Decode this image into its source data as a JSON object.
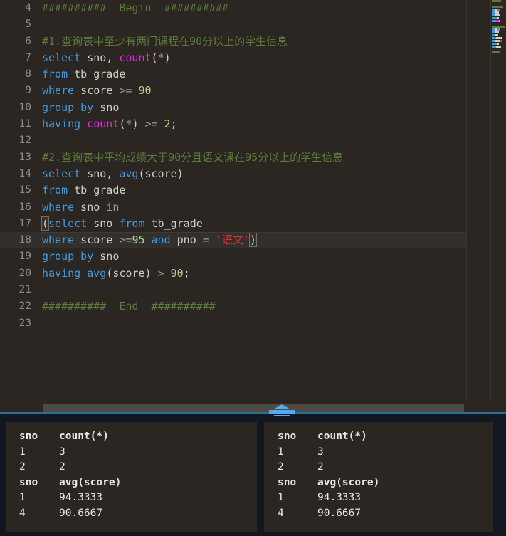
{
  "editor": {
    "first_visible_line": 4,
    "current_line": 18,
    "lines": [
      {
        "n": 4,
        "tokens": [
          {
            "t": "cmt",
            "v": "##########  Begin  ##########"
          }
        ]
      },
      {
        "n": 5,
        "tokens": []
      },
      {
        "n": 6,
        "tokens": [
          {
            "t": "cmt",
            "v": "#1.查询表中至少有两门课程在90分以上的学生信息"
          }
        ]
      },
      {
        "n": 7,
        "tokens": [
          {
            "t": "kw",
            "v": "select"
          },
          {
            "t": "id",
            "v": " sno"
          },
          {
            "t": "pun",
            "v": ", "
          },
          {
            "t": "fn",
            "v": "count"
          },
          {
            "t": "pun",
            "v": "("
          },
          {
            "t": "op",
            "v": "*"
          },
          {
            "t": "pun",
            "v": ")"
          }
        ]
      },
      {
        "n": 8,
        "tokens": [
          {
            "t": "kw",
            "v": "from"
          },
          {
            "t": "id",
            "v": " tb_grade"
          }
        ]
      },
      {
        "n": 9,
        "tokens": [
          {
            "t": "kw",
            "v": "where"
          },
          {
            "t": "id",
            "v": " score "
          },
          {
            "t": "op",
            "v": ">="
          },
          {
            "t": "num",
            "v": " 90"
          }
        ]
      },
      {
        "n": 10,
        "tokens": [
          {
            "t": "kw",
            "v": "group by"
          },
          {
            "t": "id",
            "v": " sno"
          }
        ]
      },
      {
        "n": 11,
        "tokens": [
          {
            "t": "kw",
            "v": "having"
          },
          {
            "t": "id",
            "v": " "
          },
          {
            "t": "fn",
            "v": "count"
          },
          {
            "t": "pun",
            "v": "("
          },
          {
            "t": "op",
            "v": "*"
          },
          {
            "t": "pun",
            "v": ") "
          },
          {
            "t": "op",
            "v": ">="
          },
          {
            "t": "num",
            "v": " 2"
          },
          {
            "t": "pun",
            "v": ";"
          }
        ]
      },
      {
        "n": 12,
        "tokens": []
      },
      {
        "n": 13,
        "tokens": [
          {
            "t": "cmt",
            "v": "#2.查询表中平均成绩大于90分且语文课在95分以上的学生信息"
          }
        ]
      },
      {
        "n": 14,
        "tokens": [
          {
            "t": "kw",
            "v": "select"
          },
          {
            "t": "id",
            "v": " sno"
          },
          {
            "t": "pun",
            "v": ", "
          },
          {
            "t": "kw",
            "v": "avg"
          },
          {
            "t": "pun",
            "v": "("
          },
          {
            "t": "id",
            "v": "score"
          },
          {
            "t": "pun",
            "v": ")"
          }
        ]
      },
      {
        "n": 15,
        "tokens": [
          {
            "t": "kw",
            "v": "from"
          },
          {
            "t": "id",
            "v": " tb_grade"
          }
        ]
      },
      {
        "n": 16,
        "tokens": [
          {
            "t": "kw",
            "v": "where"
          },
          {
            "t": "id",
            "v": " sno "
          },
          {
            "t": "op",
            "v": "in"
          }
        ]
      },
      {
        "n": 17,
        "tokens": [
          {
            "t": "brk",
            "v": "("
          },
          {
            "t": "kw",
            "v": "select"
          },
          {
            "t": "id",
            "v": " sno "
          },
          {
            "t": "kw",
            "v": "from"
          },
          {
            "t": "id",
            "v": " tb_grade"
          }
        ]
      },
      {
        "n": 18,
        "tokens": [
          {
            "t": "kw",
            "v": "where"
          },
          {
            "t": "id",
            "v": " score "
          },
          {
            "t": "op",
            "v": ">="
          },
          {
            "t": "num",
            "v": "95"
          },
          {
            "t": "id",
            "v": " "
          },
          {
            "t": "kw",
            "v": "and"
          },
          {
            "t": "id",
            "v": " pno "
          },
          {
            "t": "op",
            "v": "="
          },
          {
            "t": "id",
            "v": " "
          },
          {
            "t": "str",
            "v": "'语文'"
          },
          {
            "t": "brk",
            "v": ")"
          }
        ]
      },
      {
        "n": 19,
        "tokens": [
          {
            "t": "kw",
            "v": "group by"
          },
          {
            "t": "id",
            "v": " sno"
          }
        ]
      },
      {
        "n": 20,
        "tokens": [
          {
            "t": "kw",
            "v": "having"
          },
          {
            "t": "id",
            "v": " "
          },
          {
            "t": "kw",
            "v": "avg"
          },
          {
            "t": "pun",
            "v": "("
          },
          {
            "t": "id",
            "v": "score"
          },
          {
            "t": "pun",
            "v": ") "
          },
          {
            "t": "op",
            "v": ">"
          },
          {
            "t": "num",
            "v": " 90"
          },
          {
            "t": "pun",
            "v": ";"
          }
        ]
      },
      {
        "n": 21,
        "tokens": []
      },
      {
        "n": 22,
        "tokens": [
          {
            "t": "cmt",
            "v": "##########  End  ##########"
          }
        ]
      },
      {
        "n": 23,
        "tokens": []
      }
    ]
  },
  "minimap": {
    "rows": [
      [
        {
          "c": "#5d7a3a",
          "w": 13
        }
      ],
      [],
      [
        {
          "c": "#5d7a3a",
          "w": 16
        }
      ],
      [
        {
          "c": "#3f9ae0",
          "w": 5
        },
        {
          "c": "#cfcfc6",
          "w": 3
        },
        {
          "c": "#ef21ef",
          "w": 4
        }
      ],
      [
        {
          "c": "#3f9ae0",
          "w": 4
        },
        {
          "c": "#cfcfc6",
          "w": 6
        }
      ],
      [
        {
          "c": "#3f9ae0",
          "w": 5
        },
        {
          "c": "#cfcfc6",
          "w": 5
        },
        {
          "c": "#bdd08a",
          "w": 2
        }
      ],
      [
        {
          "c": "#3f9ae0",
          "w": 7
        },
        {
          "c": "#cfcfc6",
          "w": 3
        }
      ],
      [
        {
          "c": "#3f9ae0",
          "w": 6
        },
        {
          "c": "#ef21ef",
          "w": 4
        },
        {
          "c": "#bdd08a",
          "w": 2
        }
      ],
      [],
      [
        {
          "c": "#5d7a3a",
          "w": 18
        }
      ],
      [
        {
          "c": "#3f9ae0",
          "w": 5
        },
        {
          "c": "#cfcfc6",
          "w": 3
        },
        {
          "c": "#3f9ae0",
          "w": 4
        }
      ],
      [
        {
          "c": "#3f9ae0",
          "w": 4
        },
        {
          "c": "#cfcfc6",
          "w": 6
        }
      ],
      [
        {
          "c": "#3f9ae0",
          "w": 5
        },
        {
          "c": "#cfcfc6",
          "w": 4
        }
      ],
      [
        {
          "c": "#cfcfc6",
          "w": 1
        },
        {
          "c": "#3f9ae0",
          "w": 5
        },
        {
          "c": "#cfcfc6",
          "w": 8
        }
      ],
      [
        {
          "c": "#3f9ae0",
          "w": 5
        },
        {
          "c": "#cfcfc6",
          "w": 4
        },
        {
          "c": "#bdd08a",
          "w": 2
        },
        {
          "c": "#cc3333",
          "w": 3
        }
      ],
      [
        {
          "c": "#3f9ae0",
          "w": 7
        },
        {
          "c": "#cfcfc6",
          "w": 3
        }
      ],
      [
        {
          "c": "#3f9ae0",
          "w": 6
        },
        {
          "c": "#cfcfc6",
          "w": 5
        },
        {
          "c": "#bdd08a",
          "w": 2
        }
      ],
      [],
      [
        {
          "c": "#5d7a3a",
          "w": 12
        }
      ],
      []
    ]
  },
  "splitter": {
    "up_arrow": "collapse-up-arrow",
    "down_arrow": "expand-down-arrow"
  },
  "results": {
    "left_panel": {
      "tables": [
        {
          "headers": [
            "sno",
            "count(*)"
          ],
          "rows": [
            [
              "1",
              "3"
            ],
            [
              "2",
              "2"
            ]
          ]
        },
        {
          "headers": [
            "sno",
            "avg(score)"
          ],
          "rows": [
            [
              "1",
              "94.3333"
            ],
            [
              "4",
              "90.6667"
            ]
          ]
        }
      ]
    },
    "right_panel": {
      "tables": [
        {
          "headers": [
            "sno",
            "count(*)"
          ],
          "rows": [
            [
              "1",
              "3"
            ],
            [
              "2",
              "2"
            ]
          ]
        },
        {
          "headers": [
            "sno",
            "avg(score)"
          ],
          "rows": [
            [
              "1",
              "94.3333"
            ],
            [
              "4",
              "90.6667"
            ]
          ]
        }
      ]
    }
  }
}
